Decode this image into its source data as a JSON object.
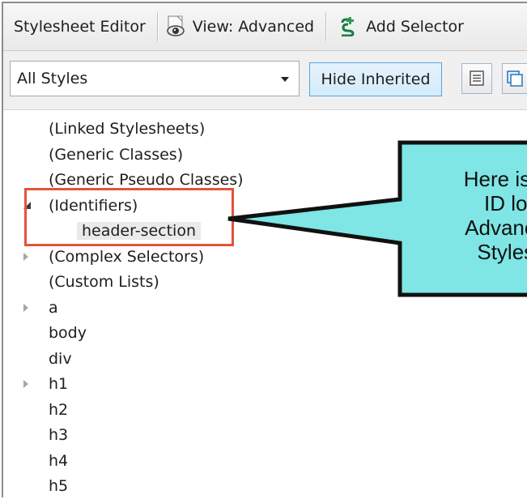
{
  "toolbar": {
    "title": "Stylesheet Editor",
    "view_label": "View: Advanced",
    "add_selector_label": "Add Selector",
    "view_icon": "eye-icon",
    "add_icon": "add-selector-icon"
  },
  "filter": {
    "selected_value": "All Styles",
    "hide_inherited_label": "Hide Inherited"
  },
  "tree": {
    "items": [
      {
        "label": "(Linked Stylesheets)",
        "expander": "none"
      },
      {
        "label": "(Generic Classes)",
        "expander": "none"
      },
      {
        "label": "(Generic Pseudo Classes)",
        "expander": "none"
      },
      {
        "label": "(Identifiers)",
        "expander": "expanded"
      },
      {
        "label": "header-section",
        "expander": "none",
        "selected": true
      },
      {
        "label": "(Complex Selectors)",
        "expander": "collapsed"
      },
      {
        "label": "(Custom Lists)",
        "expander": "none"
      },
      {
        "label": "a",
        "expander": "collapsed"
      },
      {
        "label": "body",
        "expander": "none"
      },
      {
        "label": "div",
        "expander": "none"
      },
      {
        "label": "h1",
        "expander": "collapsed"
      },
      {
        "label": "h2",
        "expander": "none"
      },
      {
        "label": "h3",
        "expander": "none"
      },
      {
        "label": "h4",
        "expander": "none"
      },
      {
        "label": "h5",
        "expander": "none"
      }
    ]
  },
  "callout": {
    "lines": [
      "Here is ho",
      "ID loo",
      "Advanced",
      "Stylesh"
    ],
    "fill_color": "#7fe5e5",
    "highlight_color": "#e2543a"
  }
}
